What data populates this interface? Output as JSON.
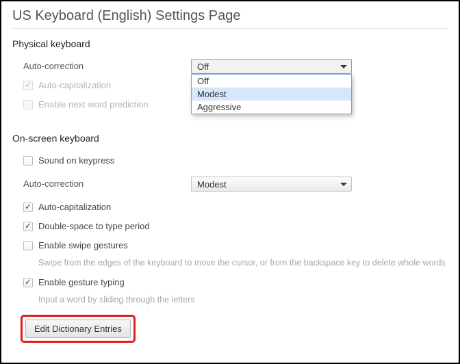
{
  "page": {
    "title": "US Keyboard (English) Settings Page"
  },
  "physical": {
    "heading": "Physical keyboard",
    "auto_correction": {
      "label": "Auto-correction",
      "value": "Off",
      "options": [
        "Off",
        "Modest",
        "Aggressive"
      ],
      "highlighted_index": 1,
      "dropdown_open": true
    },
    "auto_capitalization": {
      "label": "Auto-capitalization",
      "checked": true,
      "enabled": false
    },
    "next_word_prediction": {
      "label": "Enable next word prediction",
      "checked": false,
      "enabled": false
    }
  },
  "onscreen": {
    "heading": "On-screen keyboard",
    "sound_on_keypress": {
      "label": "Sound on keypress",
      "checked": false
    },
    "auto_correction": {
      "label": "Auto-correction",
      "value": "Modest"
    },
    "auto_capitalization": {
      "label": "Auto-capitalization",
      "checked": true
    },
    "double_space_period": {
      "label": "Double-space to type period",
      "checked": true
    },
    "swipe_gestures": {
      "label": "Enable swipe gestures",
      "checked": false,
      "help": "Swipe from the edges of the keyboard to move the cursor, or from the backspace key to delete whole words"
    },
    "gesture_typing": {
      "label": "Enable gesture typing",
      "checked": true,
      "help": "Input a word by sliding through the letters"
    },
    "edit_dictionary_button": "Edit Dictionary Entries"
  },
  "colors": {
    "callout_border": "#e11b1b",
    "focus_border": "#7a9fe0",
    "option_highlight_bg": "#d6e6fb"
  }
}
